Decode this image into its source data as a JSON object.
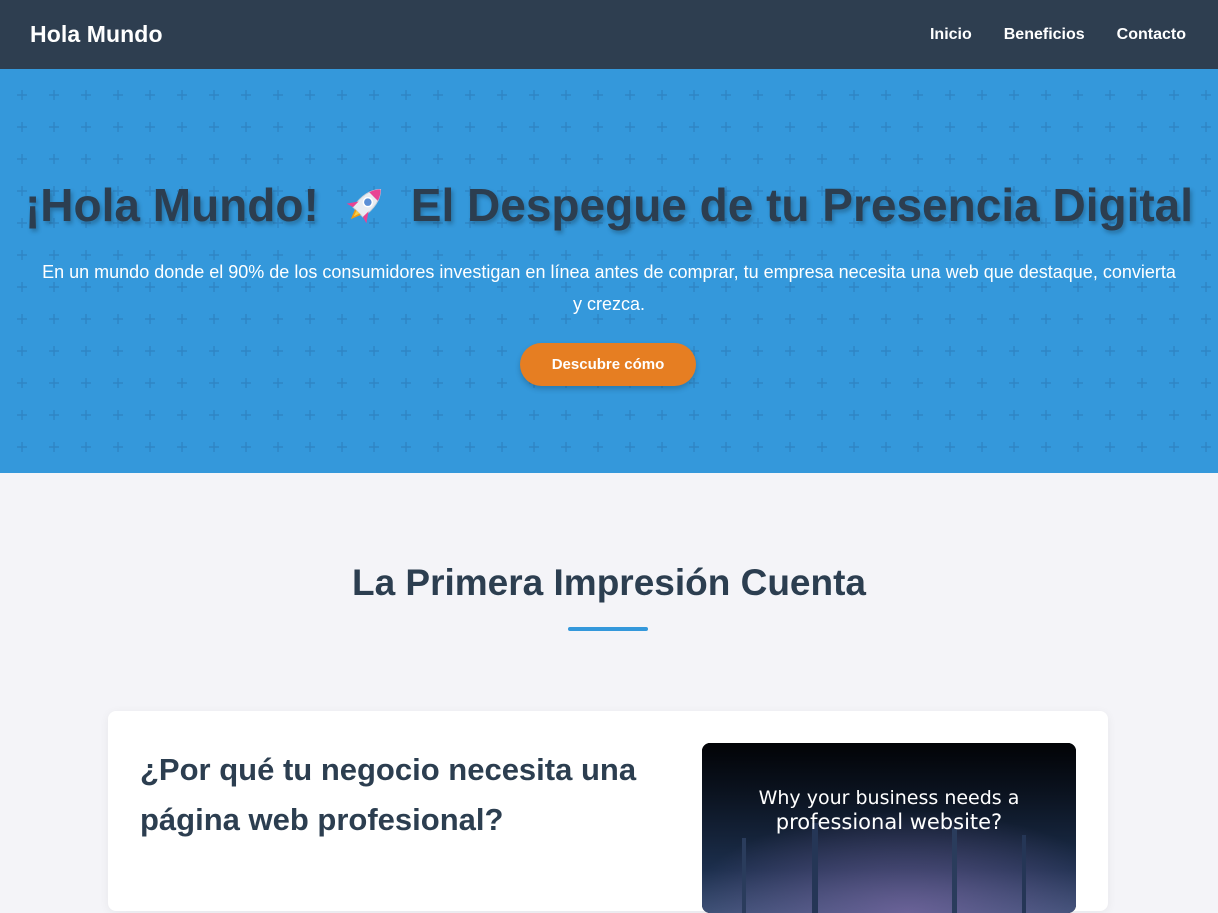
{
  "navbar": {
    "brand": "Hola Mundo",
    "links": [
      "Inicio",
      "Beneficios",
      "Contacto"
    ],
    "background": "#2e3e50"
  },
  "hero": {
    "title_part1": "¡Hola Mundo!",
    "title_icon": "rocket-icon",
    "title_part2": "El Despegue de tu Presencia Digital",
    "subtitle": "En un mundo donde el 90% de los consumidores investigan en línea antes de comprar, tu empresa necesita una web que destaque, convierta y crezca.",
    "cta_label": "Descubre cómo",
    "background": "#3498db",
    "cta_color": "#e67e22"
  },
  "section": {
    "title": "La Primera Impresión Cuenta",
    "divider_color": "#3498db"
  },
  "card": {
    "title": "¿Por qué tu negocio necesita una página web profesional?",
    "video": {
      "line1": "Why your business needs a",
      "line2": "professional website?"
    }
  }
}
